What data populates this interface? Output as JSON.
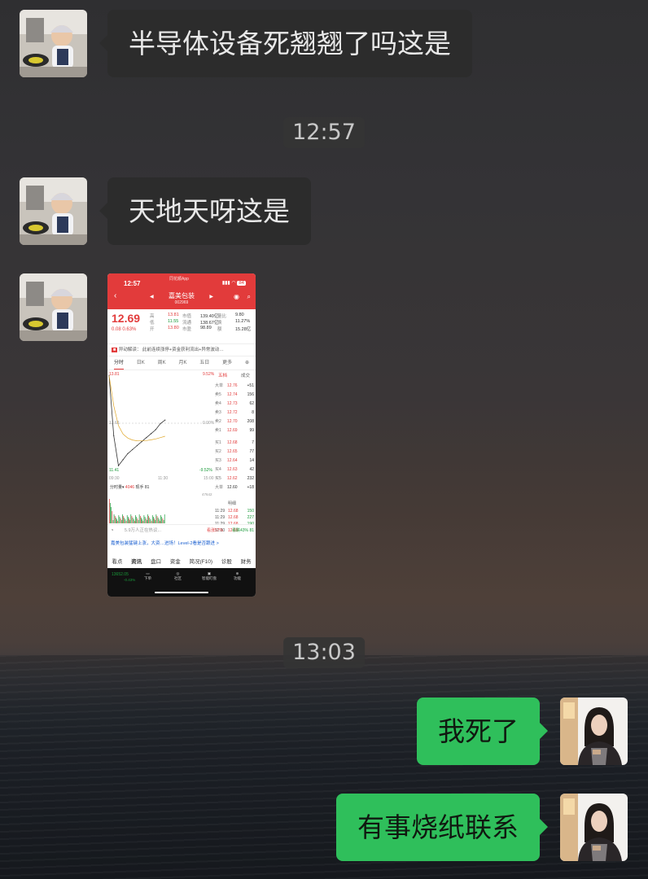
{
  "messages": [
    {
      "side": "in",
      "text": "半导体设备死翘翘了吗这是"
    },
    {
      "side": "in",
      "text": "天地天呀这是"
    },
    {
      "side": "out",
      "text": "我死了"
    },
    {
      "side": "out",
      "text": "有事烧纸联系"
    }
  ],
  "timestamps": [
    "12:57",
    "13:03"
  ],
  "screenshot": {
    "status_time": "12:57",
    "battery": "84",
    "app_tag": "同花顺App",
    "stock_name": "嘉美包装",
    "stock_code": "002969",
    "price": "12.69",
    "change": "0.08",
    "change_pct": "0.63%",
    "quote": [
      [
        "高",
        "13.81",
        "市值",
        "139.40亿",
        "量比",
        "9.80"
      ],
      [
        "低",
        "11.55",
        "流通",
        "138.67亿",
        "换",
        "11.27%"
      ],
      [
        "开",
        "13.80",
        "市盈",
        "98.89",
        "额",
        "15.28亿"
      ]
    ],
    "news_label": "异动解读",
    "news_text": "此前连续涨停+资金获利流出+异常波动…",
    "kline_tabs": [
      "分时",
      "日K",
      "周K",
      "月K",
      "五日",
      "更多"
    ],
    "chart_top_left": "13.81",
    "chart_top_right": "9.52%",
    "chart_mid_left": "12.61",
    "chart_mid_right": "0.00%",
    "chart_low_left": "11.41",
    "chart_low_right": "-9.52%",
    "time_start": "09:30",
    "time_mid": "11:30",
    "time_end": "15:00",
    "ob_header": [
      "五档",
      "成交"
    ],
    "orderbook": [
      [
        "大单",
        "12.76",
        "+51"
      ],
      [
        "卖5",
        "12.74",
        "156"
      ],
      [
        "卖4",
        "12.73",
        "62"
      ],
      [
        "卖3",
        "12.72",
        "8"
      ],
      [
        "卖2",
        "12.70",
        "208"
      ],
      [
        "卖1",
        "12.69",
        "99"
      ],
      [
        "买1",
        "12.68",
        "7"
      ],
      [
        "买2",
        "12.65",
        "77"
      ],
      [
        "买3",
        "12.64",
        "14"
      ],
      [
        "买4",
        "12.63",
        "42"
      ],
      [
        "买5",
        "12.62",
        "232"
      ],
      [
        "大单",
        "12.60",
        "+18"
      ]
    ],
    "trades_label": "明细",
    "trades": [
      [
        "11:29",
        "12.68",
        "150"
      ],
      [
        "11:29",
        "12.68",
        "227"
      ],
      [
        "11:29",
        "12.68",
        "190"
      ],
      [
        "11:30",
        "12.69",
        "81"
      ]
    ],
    "volume_label": "分时量",
    "volume_value": "4046",
    "volume_extra": "现手 81",
    "volume_axis": "47642",
    "comment_placeholder": "5.9万人正在热议...",
    "bullish": "看涨57%",
    "bearish": "看跌43%",
    "promo": "嘉美包装猛键上涨，大资…进场！Level-2看是否跟进 >",
    "bottom_tabs": [
      "看点",
      "资讯",
      "盘口",
      "资金",
      "简况(F10)",
      "诊股",
      "财务"
    ],
    "footer_index": "13652.05",
    "footer_index_chg": "-0.43%",
    "footer_actions": [
      "下单",
      "社区",
      "智能盯盘",
      "功能"
    ]
  },
  "colors": {
    "outgoing_bubble": "#2fbf5b",
    "incoming_bubble": "#2c2c2c",
    "stock_red": "#e23b3b",
    "stock_green": "#1a9a3a"
  },
  "chart_data": {
    "type": "line",
    "x": [
      "09:30",
      "09:40",
      "09:50",
      "10:00",
      "10:10",
      "10:20",
      "10:30",
      "10:40",
      "10:50",
      "11:00",
      "11:10",
      "11:20",
      "11:30"
    ],
    "series": [
      {
        "values": [
          13.8,
          12.3,
          11.55,
          11.7,
          11.85,
          11.95,
          12.05,
          12.15,
          12.25,
          12.35,
          12.45,
          12.6,
          12.69
        ]
      }
    ],
    "ylim": [
      11.41,
      13.81
    ]
  }
}
